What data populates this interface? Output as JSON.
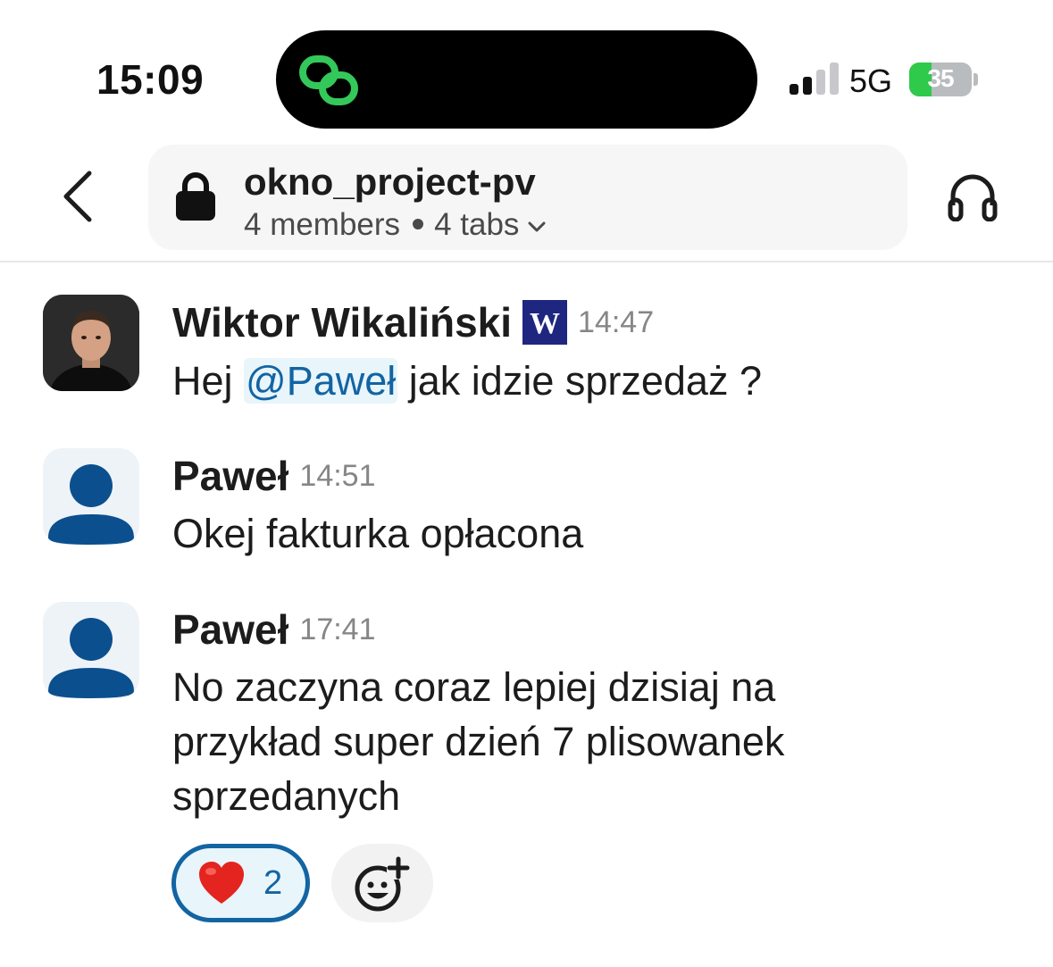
{
  "status_bar": {
    "time": "15:09",
    "network": "5G",
    "battery_level": "35",
    "battery_fraction": 0.35,
    "signal_bars_active": 2,
    "island_icon": "link-loop-icon",
    "colors": {
      "battery_fill": "#2fc94b",
      "island_icon": "#34c759"
    }
  },
  "header": {
    "back_icon": "chevron-left-icon",
    "channel_icon": "lock-icon",
    "channel_name": "okno_project-pv",
    "members": "4 members",
    "tabs": "4 tabs",
    "expand_icon": "chevron-down-icon",
    "huddle_icon": "headphones-icon"
  },
  "messages": [
    {
      "sender": "Wiktor Wikaliński",
      "badge": "W",
      "time": "14:47",
      "text_before": "Hej ",
      "mention": "@Paweł",
      "text_after": " jak idzie sprzedaż ?",
      "avatar": "photo"
    },
    {
      "sender": "Paweł",
      "time": "14:51",
      "text": "Okej fakturka opłacona",
      "avatar": "default-user-icon"
    },
    {
      "sender": "Paweł",
      "time": "17:41",
      "text": "No zaczyna coraz lepiej dzisiaj na przykład super dzień 7 plisowanek sprzedanych",
      "avatar": "default-user-icon"
    }
  ],
  "reactions": [
    {
      "emoji": "heart-emoji",
      "count": "2"
    }
  ],
  "add_reaction_icon": "add-emoji-icon",
  "colors": {
    "accent": "#1264a3",
    "mention_bg": "#e8f5fa",
    "badge_bg": "#1e2680",
    "avatar_default": "#0b4f8e"
  }
}
